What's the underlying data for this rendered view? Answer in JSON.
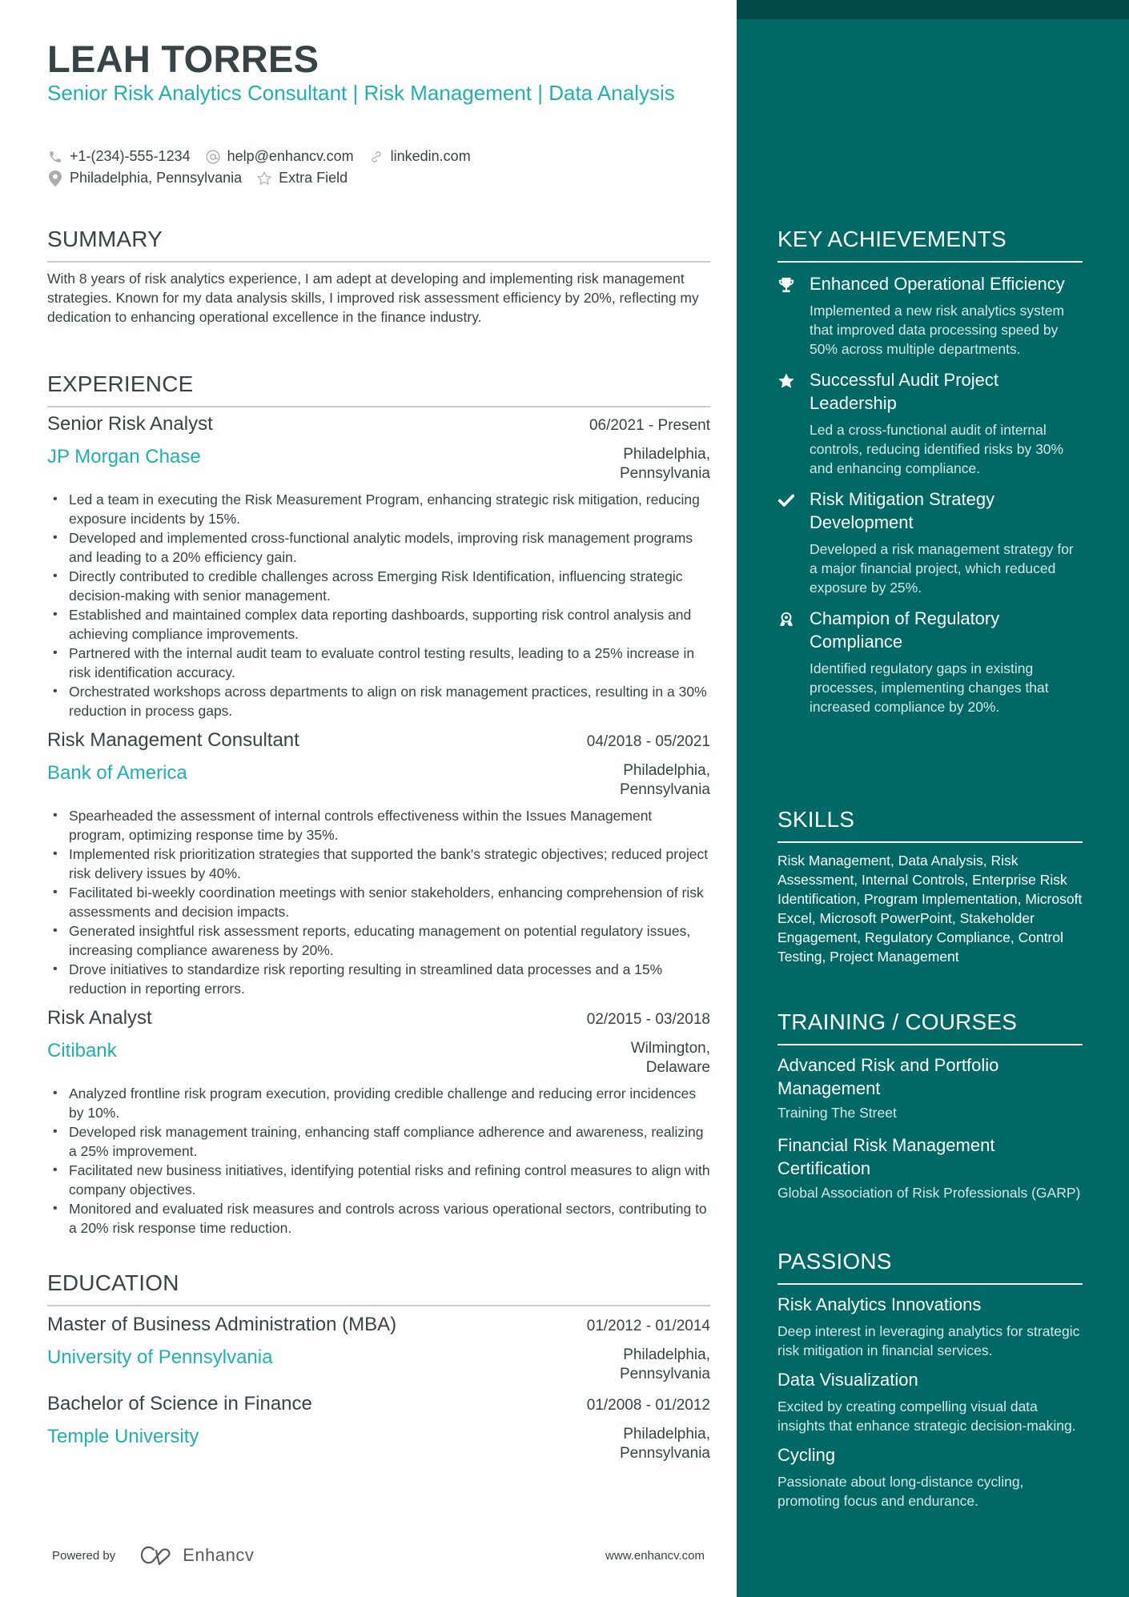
{
  "header": {
    "name": "LEAH TORRES",
    "headline": "Senior Risk Analytics Consultant | Risk Management | Data Analysis",
    "contacts": [
      {
        "icon": "phone-icon",
        "text": "+1-(234)-555-1234"
      },
      {
        "icon": "at-icon",
        "text": "help@enhancv.com"
      },
      {
        "icon": "link-icon",
        "text": "linkedin.com"
      },
      {
        "icon": "location-pin-icon",
        "text": "Philadelphia, Pennsylvania"
      },
      {
        "icon": "star-outline-icon",
        "text": "Extra Field"
      }
    ]
  },
  "summary": {
    "title": "SUMMARY",
    "text": "With 8 years of risk analytics experience, I am adept at developing and implementing risk management strategies. Known for my data analysis skills, I improved risk assessment efficiency by 20%, reflecting my dedication to enhancing operational excellence in the finance industry."
  },
  "experience": {
    "title": "EXPERIENCE",
    "jobs": [
      {
        "title": "Senior Risk Analyst",
        "dates": "06/2021 - Present",
        "company": "JP Morgan Chase",
        "location_line1": "Philadelphia,",
        "location_line2": "Pennsylvania",
        "bullets": [
          "Led a team in executing the Risk Measurement Program, enhancing strategic risk mitigation, reducing exposure incidents by 15%.",
          "Developed and implemented cross-functional analytic models, improving risk management programs and leading to a 20% efficiency gain.",
          "Directly contributed to credible challenges across Emerging Risk Identification, influencing strategic decision-making with senior management.",
          "Established and maintained complex data reporting dashboards, supporting risk control analysis and achieving compliance improvements.",
          "Partnered with the internal audit team to evaluate control testing results, leading to a 25% increase in risk identification accuracy.",
          "Orchestrated workshops across departments to align on risk management practices, resulting in a 30% reduction in process gaps."
        ]
      },
      {
        "title": "Risk Management Consultant",
        "dates": "04/2018 - 05/2021",
        "company": "Bank of America",
        "location_line1": "Philadelphia,",
        "location_line2": "Pennsylvania",
        "bullets": [
          "Spearheaded the assessment of internal controls effectiveness within the Issues Management program, optimizing response time by 35%.",
          "Implemented risk prioritization strategies that supported the bank's strategic objectives; reduced project risk delivery issues by 40%.",
          "Facilitated bi-weekly coordination meetings with senior stakeholders, enhancing comprehension of risk assessments and decision impacts.",
          "Generated insightful risk assessment reports, educating management on potential regulatory issues, increasing compliance awareness by 20%.",
          "Drove initiatives to standardize risk reporting resulting in streamlined data processes and a 15% reduction in reporting errors."
        ]
      },
      {
        "title": "Risk Analyst",
        "dates": "02/2015 - 03/2018",
        "company": "Citibank",
        "location_line1": "Wilmington,",
        "location_line2": "Delaware",
        "bullets": [
          "Analyzed frontline risk program execution, providing credible challenge and reducing error incidences by 10%.",
          "Developed risk management training, enhancing staff compliance adherence and awareness, realizing a 25% improvement.",
          "Facilitated new business initiatives, identifying potential risks and refining control measures to align with company objectives.",
          "Monitored and evaluated risk measures and controls across various operational sectors, contributing to a 20% risk response time reduction."
        ]
      }
    ]
  },
  "education": {
    "title": "EDUCATION",
    "items": [
      {
        "degree": "Master of Business Administration (MBA)",
        "dates": "01/2012 - 01/2014",
        "school": "University of Pennsylvania",
        "location_line1": "Philadelphia,",
        "location_line2": "Pennsylvania"
      },
      {
        "degree": "Bachelor of Science in Finance",
        "dates": "01/2008 - 01/2012",
        "school": "Temple University",
        "location_line1": "Philadelphia,",
        "location_line2": "Pennsylvania"
      }
    ]
  },
  "achievements": {
    "title": "KEY ACHIEVEMENTS",
    "items": [
      {
        "icon": "trophy-icon",
        "title": "Enhanced Operational Efficiency",
        "desc": "Implemented a new risk analytics system that improved data processing speed by 50% across multiple departments."
      },
      {
        "icon": "star-icon",
        "title": "Successful Audit Project Leadership",
        "desc": "Led a cross-functional audit of internal controls, reducing identified risks by 30% and enhancing compliance."
      },
      {
        "icon": "checkmark-icon",
        "title": "Risk Mitigation Strategy Development",
        "desc": "Developed a risk management strategy for a major financial project, which reduced exposure by 25%."
      },
      {
        "icon": "award-ribbon-icon",
        "title": "Champion of Regulatory Compliance",
        "desc": "Identified regulatory gaps in existing processes, implementing changes that increased compliance by 20%."
      }
    ]
  },
  "skills": {
    "title": "SKILLS",
    "text": "Risk Management, Data Analysis, Risk Assessment, Internal Controls, Enterprise Risk Identification, Program Implementation, Microsoft Excel, Microsoft PowerPoint, Stakeholder Engagement, Regulatory Compliance, Control Testing, Project Management"
  },
  "training": {
    "title": "TRAINING / COURSES",
    "items": [
      {
        "title": "Advanced Risk and Portfolio Management",
        "org": "Training The Street"
      },
      {
        "title": "Financial Risk Management Certification",
        "org": "Global Association of Risk Professionals (GARP)"
      }
    ]
  },
  "passions": {
    "title": "PASSIONS",
    "items": [
      {
        "title": "Risk Analytics Innovations",
        "desc": "Deep interest in leveraging analytics for strategic risk mitigation in financial services."
      },
      {
        "title": "Data Visualization",
        "desc": "Excited by creating compelling visual data insights that enhance strategic decision-making."
      },
      {
        "title": "Cycling",
        "desc": "Passionate about long-distance cycling, promoting focus and endurance."
      }
    ]
  },
  "footer": {
    "powered_by": "Powered by",
    "brand": "Enhancv",
    "website": "www.enhancv.com"
  },
  "colors": {
    "accent": "#1fb0b2",
    "sidebar_bg": "#006865",
    "sidebar_top_band": "#004a48",
    "text": "#384347"
  }
}
